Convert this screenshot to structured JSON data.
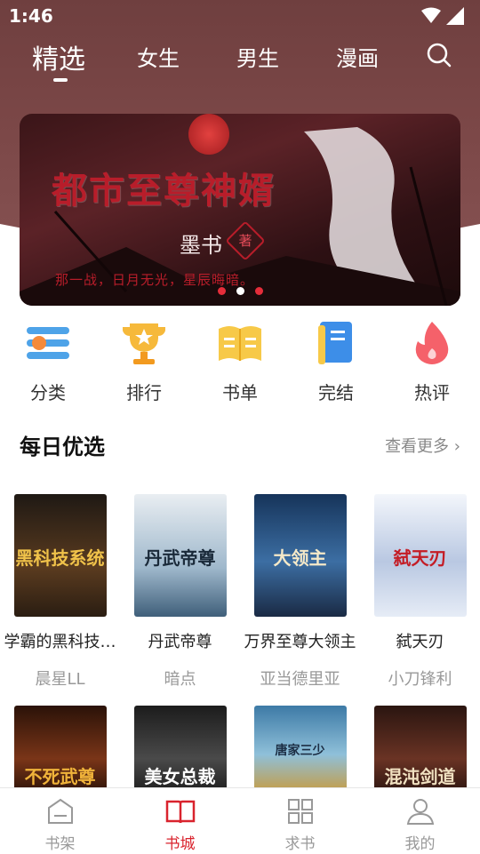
{
  "status": {
    "time": "1:46"
  },
  "tabs": [
    {
      "label": "精选",
      "active": true
    },
    {
      "label": "女生",
      "active": false
    },
    {
      "label": "男生",
      "active": false
    },
    {
      "label": "漫画",
      "active": false
    }
  ],
  "banner": {
    "title": "都市至尊神婿",
    "author": "墨书",
    "stamp": "著",
    "slogan": "那一战，日月无光，星辰晦暗。",
    "slide_count": 3,
    "active_slide": 2
  },
  "categories": [
    {
      "label": "分类",
      "icon": "category-icon"
    },
    {
      "label": "排行",
      "icon": "trophy-icon"
    },
    {
      "label": "书单",
      "icon": "booklist-icon"
    },
    {
      "label": "完结",
      "icon": "finished-book-icon"
    },
    {
      "label": "热评",
      "icon": "flame-icon"
    }
  ],
  "daily": {
    "title": "每日优选",
    "more": "查看更多",
    "books": [
      {
        "title": "学霸的黑科技…",
        "author": "晨星LL",
        "cover_text": "黑科技系统",
        "cover_color": "#3a2a1c"
      },
      {
        "title": "丹武帝尊",
        "author": "暗点",
        "cover_text": "丹武帝尊",
        "cover_color": "#a9c3d6"
      },
      {
        "title": "万界至尊大领主",
        "author": "亚当德里亚",
        "cover_text": "大领主",
        "cover_color": "#2a4f78"
      },
      {
        "title": "弑天刃",
        "author": "小刀锋利",
        "cover_text": "弑天刃",
        "cover_color": "#dbe3ef"
      }
    ],
    "books_row2": [
      {
        "cover_text": "不死武尊",
        "cover_color": "#5a2a18"
      },
      {
        "cover_text": "美女总裁",
        "cover_color": "#2b2b2b"
      },
      {
        "cover_text": "唐家三少",
        "cover_color": "#3d7aa6"
      },
      {
        "cover_text": "混沌剑道",
        "cover_color": "#3a1e14"
      }
    ]
  },
  "nav": [
    {
      "label": "书架",
      "icon": "bookshelf-icon",
      "active": false
    },
    {
      "label": "书城",
      "icon": "book-open-icon",
      "active": true
    },
    {
      "label": "求书",
      "icon": "grid-icon",
      "active": false
    },
    {
      "label": "我的",
      "icon": "user-icon",
      "active": false
    }
  ],
  "colors": {
    "accent": "#d9232d",
    "header": "#7b4747"
  }
}
